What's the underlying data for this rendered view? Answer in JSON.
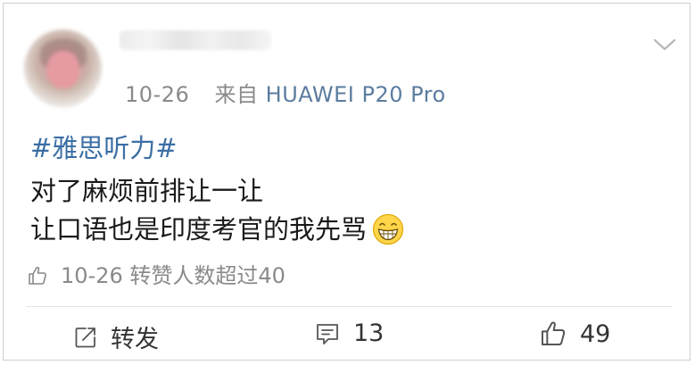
{
  "post": {
    "author": {
      "username": "",
      "avatar": "blurred-avatar"
    },
    "date": "10-26",
    "source_prefix": "来自",
    "device": "HUAWEI P20 Pro",
    "topic": "#雅思听力#",
    "lines": [
      "对了麻烦前排让一让",
      "让口语也是印度考官的我先骂"
    ],
    "emoji": "grinning-face-emoji",
    "like_summary": {
      "date": "10-26",
      "text": "转赞人数超过40"
    }
  },
  "actions": {
    "repost_label": "转发",
    "comment_count": "13",
    "like_count": "49"
  },
  "colors": {
    "link": "#3b6ea5",
    "device": "#5b7ca0",
    "meta_gray": "#8a8a8a",
    "text": "#1a1a1a"
  }
}
